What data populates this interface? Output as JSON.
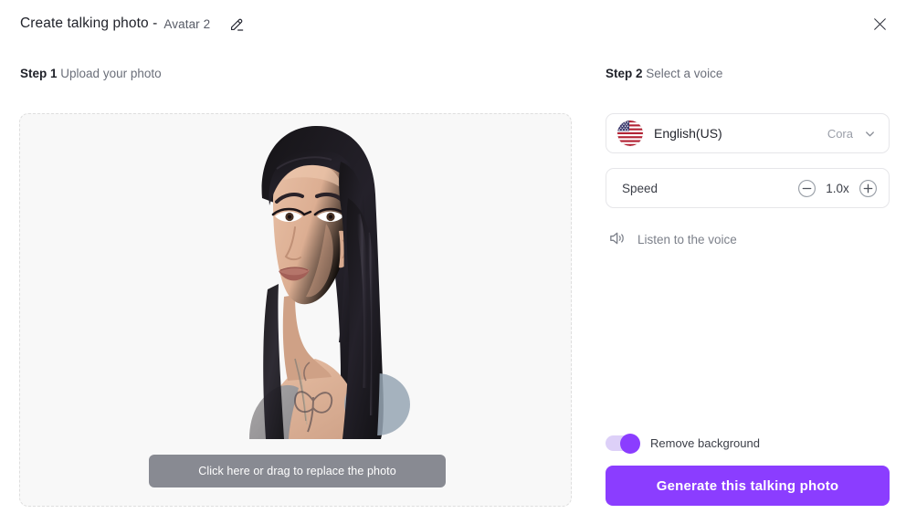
{
  "header": {
    "title": "Create talking photo -",
    "avatar_name": "Avatar 2",
    "edit_icon": "pencil-icon",
    "close_icon": "close-icon"
  },
  "steps": {
    "step1_number": "Step 1",
    "step1_text": "Upload your photo",
    "step2_number": "Step 2",
    "step2_text": "Select a voice"
  },
  "photo": {
    "replace_label": "Click here or drag to replace the photo",
    "description": "Portrait photo of a woman with long straight dark hair, shoulder tattoo"
  },
  "voice": {
    "flag_icon": "us-flag-icon",
    "language": "English(US)",
    "voice_name": "Cora",
    "chevron_icon": "chevron-down-icon"
  },
  "speed": {
    "label": "Speed",
    "value": "1.0x",
    "decrease_icon": "minus-circle-icon",
    "increase_icon": "plus-circle-icon"
  },
  "listen": {
    "icon": "speaker-icon",
    "label": "Listen to the voice"
  },
  "remove_background": {
    "label": "Remove background",
    "enabled": true
  },
  "generate": {
    "label": "Generate this talking photo"
  },
  "colors": {
    "accent": "#8b3dff",
    "toggle_track": "#ddd0f8",
    "overlay_button": "#686a74",
    "panel_bg": "#f8f8f8",
    "border": "#e6e6e9"
  }
}
